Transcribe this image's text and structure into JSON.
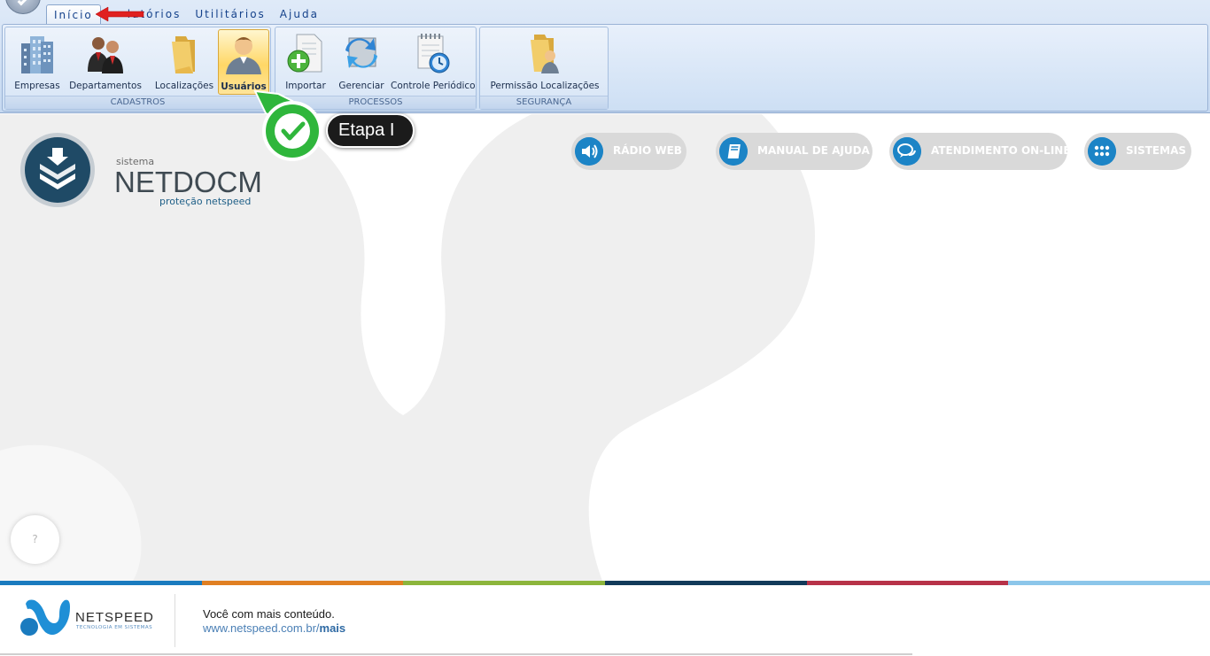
{
  "ribbon": {
    "tabs": [
      {
        "label": "Início",
        "active": true
      },
      {
        "label": "Relatórios",
        "visible_text": "latórios"
      },
      {
        "label": "Utilitários"
      },
      {
        "label": "Ajuda"
      }
    ],
    "groups": {
      "cadastros": {
        "label": "CADASTROS",
        "buttons": [
          {
            "label": "Empresas",
            "icon": "buildings-icon"
          },
          {
            "label": "Departamentos",
            "icon": "people-icon"
          },
          {
            "label": "Localizações",
            "icon": "folder-icon"
          },
          {
            "label": "Usuários",
            "icon": "user-icon",
            "selected": true
          }
        ]
      },
      "processos": {
        "label": "PROCESSOS",
        "buttons": [
          {
            "label": "Importar",
            "icon": "document-add-icon"
          },
          {
            "label": "Gerenciar",
            "icon": "sync-icon"
          },
          {
            "label": "Controle Periódico",
            "icon": "calendar-clock-icon"
          }
        ]
      },
      "seguranca": {
        "label": "SEGURANÇA",
        "buttons": [
          {
            "label": "Permissão Localizações",
            "icon": "folder-user-icon"
          }
        ]
      }
    }
  },
  "annotation": {
    "step_label": "Etapa I",
    "badge_icon": "checkmark-icon",
    "arrow_icon": "red-arrow-icon"
  },
  "brand": {
    "small_label": "sistema",
    "name": "NETDOCM",
    "tagline": "proteção netspeed",
    "logo_icon": "netdocm-logo-icon"
  },
  "quick_links": [
    {
      "label": "RÁDIO WEB",
      "icon": "speaker-icon"
    },
    {
      "label": "MANUAL DE AJUDA",
      "icon": "book-icon"
    },
    {
      "label": "ATENDIMENTO ON-LINE",
      "icon": "chat-icon"
    },
    {
      "label": "SISTEMAS",
      "icon": "grid-dots-icon"
    }
  ],
  "help_bubble": {
    "label": "?"
  },
  "footer": {
    "brand": "NETSPEED",
    "brand_sub": "TECNOLOGIA EM SISTEMAS",
    "text": "Você com mais conteúdo.",
    "link_prefix": "www.netspeed.com.br/",
    "link_bold": "mais"
  },
  "colors": {
    "accent": "#1c84c6",
    "badge_green": "#2fb63c",
    "pill_bg": "#d9d9d9",
    "strip": [
      "#1a7bbf",
      "#e07f22",
      "#8cb53c",
      "#123a5a",
      "#b73248",
      "#8cc6ea"
    ]
  }
}
